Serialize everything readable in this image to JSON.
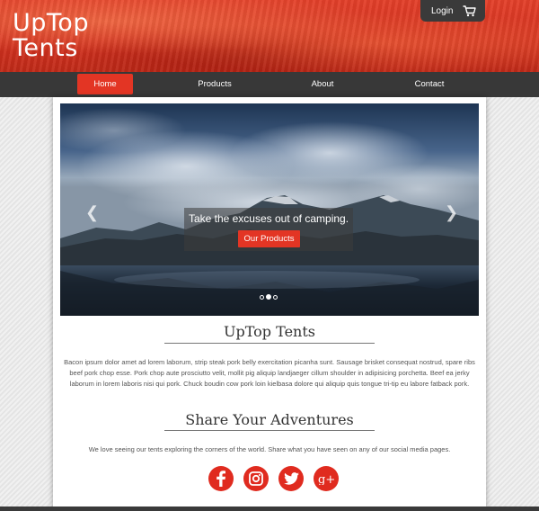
{
  "brand": {
    "line1": "UpTop",
    "line2": "Tents"
  },
  "header": {
    "login_label": "Login",
    "cart_icon": "shopping-cart-icon"
  },
  "nav": {
    "items": [
      {
        "label": "Home",
        "active": true
      },
      {
        "label": "Products",
        "active": false
      },
      {
        "label": "About",
        "active": false
      },
      {
        "label": "Contact",
        "active": false
      }
    ]
  },
  "carousel": {
    "caption": "Take the excuses out of camping.",
    "button_label": "Our Products",
    "prev_icon": "chevron-left-icon",
    "next_icon": "chevron-right-icon",
    "slides_count": 3,
    "active_slide": 2
  },
  "about": {
    "title": "UpTop Tents",
    "body": "Bacon ipsum dolor amet ad lorem laborum, strip steak pork belly exercitation picanha sunt. Sausage brisket consequat nostrud, spare ribs beef pork chop esse. Pork chop aute prosciutto velit, mollit pig aliquip landjaeger cillum shoulder in adipisicing porchetta. Beef ea jerky laborum in lorem laboris nisi qui pork. Chuck boudin cow pork loin kielbasa dolore qui aliquip quis tongue tri-tip eu labore fatback pork."
  },
  "share": {
    "title": "Share Your Adventures",
    "body": "We love seeing our tents exploring the corners of the world. Share what you have seen on any of our social media pages.",
    "icons": [
      "facebook-icon",
      "instagram-icon",
      "twitter-icon",
      "google-plus-icon"
    ]
  },
  "colors": {
    "accent": "#e33524",
    "nav_bg": "#383838",
    "header_red": "#d43220"
  }
}
